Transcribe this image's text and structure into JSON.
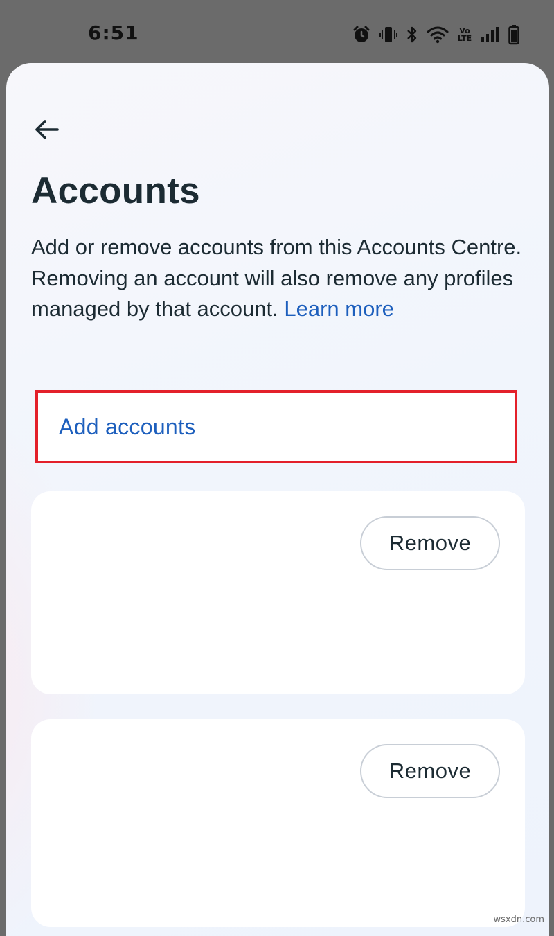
{
  "status_bar": {
    "time": "6:51",
    "icons": [
      "alarm-icon",
      "vibrate-icon",
      "bluetooth-icon",
      "wifi-icon",
      "volte-icon",
      "signal-icon",
      "battery-icon"
    ],
    "volte_text": "Vo LTE"
  },
  "header": {
    "back_icon": "arrow-left-icon",
    "title": "Accounts"
  },
  "description": {
    "text": "Add or remove accounts from this Accounts Centre. Removing an account will also remove any profiles managed by that account. ",
    "link_label": "Learn more"
  },
  "add_accounts": {
    "label": "Add accounts",
    "highlight_color": "#e3202a"
  },
  "accounts": [
    {
      "remove_label": "Remove"
    },
    {
      "remove_label": "Remove"
    }
  ],
  "watermark": "wsxdn.com",
  "colors": {
    "link": "#1d5fbd",
    "text": "#1c2b33",
    "highlight": "#e3202a"
  }
}
